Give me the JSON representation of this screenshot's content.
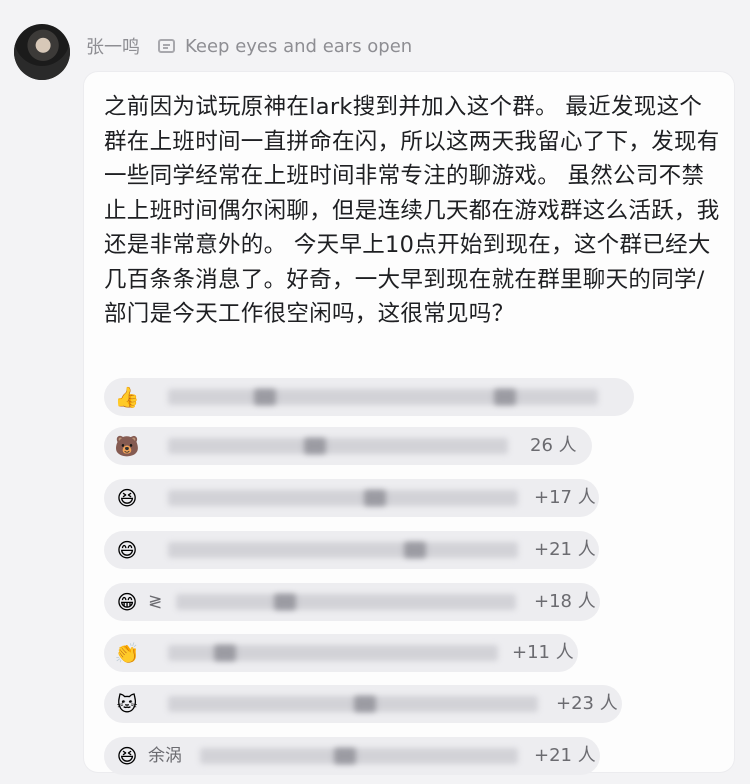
{
  "post": {
    "author": "张一鸣",
    "signature": "Keep eyes and ears open",
    "signature_icon": "signature-card-icon",
    "body": "之前因为试玩原神在lark搜到并加入这个群。 最近发现这个群在上班时间一直拼命在闪，所以这两天我留心了下，发现有一些同学经常在上班时间非常专注的聊游戏。 虽然公司不禁止上班时间偶尔闲聊，但是连续几天都在游戏群这么活跃，我还是非常意外的。 今天早上10点开始到现在，这个群已经大几百条条消息了。好奇，一大早到现在就在群里聊天的同学/部门是今天工作很空闲吗，这很常见吗？"
  },
  "reactions": [
    {
      "emoji": "👍",
      "icon": "thumbs-up-icon",
      "count": "",
      "prefix": ""
    },
    {
      "emoji": "🐻",
      "icon": "bear-face-icon",
      "count": "26 人",
      "prefix": ""
    },
    {
      "emoji": "😆",
      "icon": "laughing-face-icon",
      "count": "+17 人",
      "prefix": ""
    },
    {
      "emoji": "😄",
      "icon": "grinning-face-icon",
      "count": "+21 人",
      "prefix": ""
    },
    {
      "emoji": "😁",
      "icon": "beaming-face-icon",
      "count": "+18 人",
      "prefix": "≷"
    },
    {
      "emoji": "👏",
      "icon": "clapping-hands-icon",
      "count": "+11 人",
      "prefix": ""
    },
    {
      "emoji": "🐱",
      "icon": "cat-face-icon",
      "count": "+23 人",
      "prefix": ""
    },
    {
      "emoji": "😆",
      "icon": "laughing-face-icon",
      "count": "+21 人",
      "prefix": "余涡"
    }
  ],
  "colors": {
    "bubble": "#fdfdfd",
    "pill": "#ededf0",
    "background": "#f3f3f5"
  }
}
